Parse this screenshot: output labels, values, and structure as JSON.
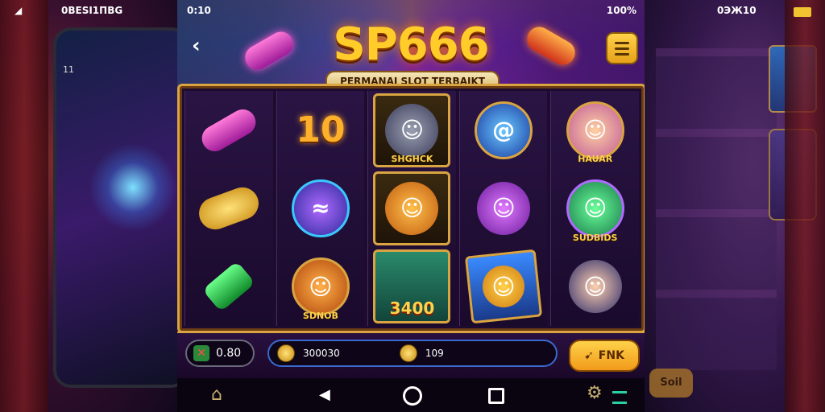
{
  "left_background": {
    "status_time": "0BESI1ПBG",
    "status_signal": "◢",
    "phone_label": "11"
  },
  "right_background": {
    "status_time": "0ЭЖ10",
    "button_label": "Soil"
  },
  "status_bar": {
    "time": "0:10",
    "battery": "100%"
  },
  "header": {
    "logo": "SP666",
    "tagline": "PERMANAI SLOT TERBAIKT",
    "back_icon": "chevron-left-icon",
    "menu_icon": "menu-icon"
  },
  "reels": [
    {
      "symbols": [
        {
          "kind": "pink-gem",
          "caption": ""
        },
        {
          "kind": "gold-coin",
          "caption": ""
        },
        {
          "kind": "green-gem",
          "caption": ""
        }
      ]
    },
    {
      "symbols": [
        {
          "kind": "ten",
          "caption": "10"
        },
        {
          "kind": "blue-fish-orb",
          "caption": ""
        },
        {
          "kind": "lion-cat",
          "caption": "SDNOB"
        }
      ]
    },
    {
      "symbols": [
        {
          "kind": "grey-cat-framed",
          "caption": "SHGHCK"
        },
        {
          "kind": "orange-cat-framed",
          "caption": ""
        },
        {
          "kind": "fruit-basket-framed",
          "caption": "3400"
        }
      ]
    },
    {
      "symbols": [
        {
          "kind": "blue-orb",
          "caption": ""
        },
        {
          "kind": "purple-wolf",
          "caption": ""
        },
        {
          "kind": "fox-card",
          "caption": ""
        }
      ]
    },
    {
      "symbols": [
        {
          "kind": "fox-girl-badge",
          "caption": "HAUAR"
        },
        {
          "kind": "green-cat-badge",
          "caption": "SUDBIDS"
        },
        {
          "kind": "dark-girl",
          "caption": ""
        }
      ]
    }
  ],
  "controls": {
    "bet_value": "0.80",
    "balance_value": "300030",
    "win_value": "109",
    "spin_label": "FNK",
    "spin_icon": "lightning-icon"
  },
  "colors": {
    "gold": "#d9a441",
    "accent_purple": "#5a1c8a",
    "spin_button": "#ffd24a"
  }
}
